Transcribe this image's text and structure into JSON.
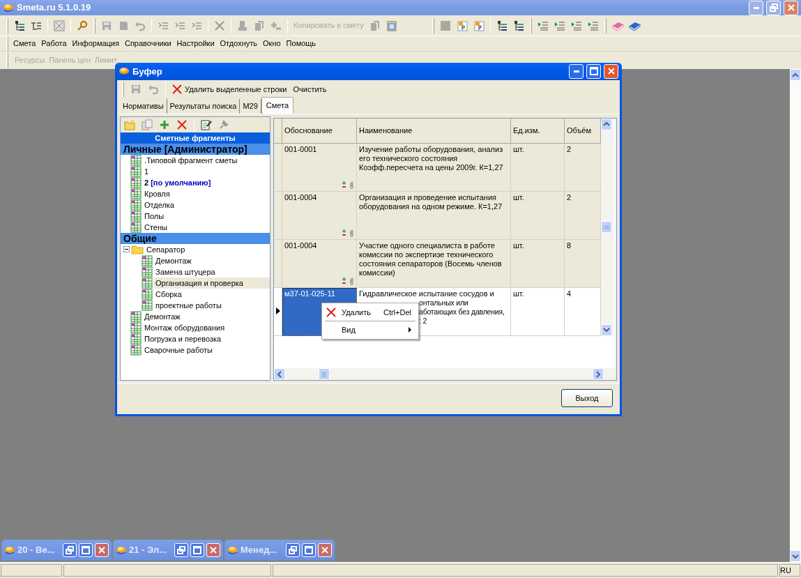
{
  "window": {
    "title": "Smeta.ru  5.1.0.19"
  },
  "toolbar": {
    "copy_button": {
      "label": "Копировать в смету",
      "disabled": true
    }
  },
  "menu": [
    {
      "label": "Смета"
    },
    {
      "label": "Работа"
    },
    {
      "label": "Информация"
    },
    {
      "label": "Справочники"
    },
    {
      "label": "Настройки"
    },
    {
      "label": "Отдохнуть"
    },
    {
      "label": "Окно"
    },
    {
      "label": "Помощь"
    }
  ],
  "panel_bar": [
    {
      "label": "Ресурсы",
      "disabled": true
    },
    {
      "label": "Панель цен",
      "disabled": true
    },
    {
      "label": "Лимит",
      "disabled": true
    }
  ],
  "dialog": {
    "title": "Буфер",
    "toolbar": [
      {
        "label": "Удалить выделенные строки",
        "kind": "delete"
      },
      {
        "label": "Очистить",
        "kind": "plain"
      }
    ],
    "tabs": [
      {
        "label": "Нормативы",
        "selected": false
      },
      {
        "label": "Результаты поиска",
        "selected": false
      },
      {
        "label": "М29",
        "selected": false
      },
      {
        "label": "Смета",
        "selected": true
      }
    ],
    "tree": {
      "title": "Сметные фрагменты",
      "groups": [
        {
          "label": "Личные [Администратор]",
          "items": [
            {
              "label": ".Типовой фрагмент сметы",
              "selected": false
            },
            {
              "label": "1",
              "selected": false
            },
            {
              "label": "2",
              "note": "[по умолчанию]",
              "selected": false
            },
            {
              "label": "Кровля",
              "selected": false
            },
            {
              "label": "Отделка",
              "selected": false
            },
            {
              "label": "Полы",
              "selected": false
            },
            {
              "label": "Стены",
              "selected": false
            }
          ]
        },
        {
          "label": "Общие",
          "items": [
            {
              "label": "Сепаратор",
              "kind": "folder",
              "expanded": true,
              "selected": false,
              "children": [
                {
                  "label": "Демонтаж",
                  "selected": false
                },
                {
                  "label": "Замена штуцера",
                  "selected": false
                },
                {
                  "label": "Организация и проверка",
                  "selected": true
                },
                {
                  "label": "Сборка",
                  "selected": false
                },
                {
                  "label": "проектные работы",
                  "selected": false
                }
              ]
            },
            {
              "label": "Демонтаж",
              "selected": false
            },
            {
              "label": "Монтаж оборудования",
              "selected": false
            },
            {
              "label": "Погрузка и перевозка",
              "selected": false
            },
            {
              "label": "Сварочные работы",
              "selected": false
            }
          ]
        }
      ]
    },
    "grid": {
      "columns": [
        "Обоснование",
        "Наименование",
        "Ед.изм.",
        "Объём"
      ],
      "rows": [
        {
          "code": "001-0001",
          "name": "Изучение работы оборудования, анализ его технического состояния Коэфф.пересчета на цены 2009г. К=1,27",
          "unit": "шт.",
          "qty": "2",
          "has_icons": true,
          "selected": false
        },
        {
          "code": "001-0004",
          "name": "Организация и проведение испытания оборудования на одном режиме. К=1,27",
          "unit": "шт.",
          "qty": "2",
          "has_icons": true,
          "selected": false
        },
        {
          "code": "001-0004",
          "name": "Участие одного специалиста в работе комиссии по экспертизе технического состояния сепараторов (Восемь членов комиссии)",
          "unit": "шт.",
          "qty": "8",
          "has_icons": true,
          "selected": false
        },
        {
          "code": "м37-01-025-11",
          "name": "Гидравлическое испытание сосудов и",
          "name_fragments": [
            "онтальных или",
            "аботающих без давления,",
            ": 2"
          ],
          "unit": "шт.",
          "qty": "4",
          "has_icons": false,
          "selected": true
        }
      ]
    },
    "context_menu": [
      {
        "label": "Удалить",
        "shortcut": "Ctrl+Del",
        "kind": "command"
      },
      {
        "label": "Вид",
        "kind": "submenu"
      }
    ],
    "exit_button": "Выход"
  },
  "minimized_windows": [
    {
      "title": "20 - Ве..."
    },
    {
      "title": "21 - Эл..."
    },
    {
      "title": "Менед..."
    }
  ],
  "status_bar": {
    "language": "RU"
  }
}
